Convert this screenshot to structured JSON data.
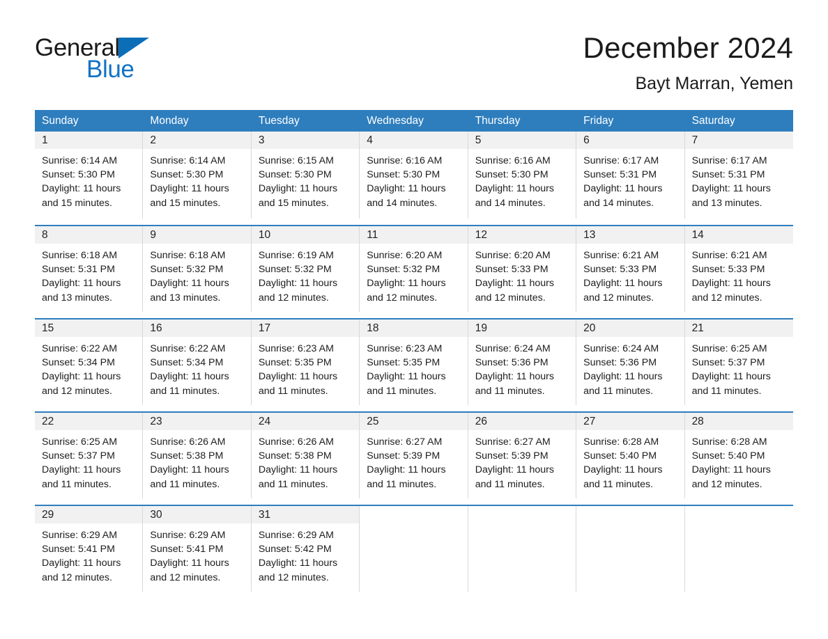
{
  "brand": {
    "name_part1": "General",
    "name_part2": "Blue",
    "triangle_color": "#0d6eb8",
    "blue_text_color": "#1272c4"
  },
  "header": {
    "title": "December 2024",
    "subtitle": "Bayt Marran, Yemen"
  },
  "theme": {
    "header_blue": "#2e7ebe",
    "daynum_band": "#f1f1f1",
    "text": "#1c1c1c",
    "cell_border": "#d8d8d8"
  },
  "weekdays": [
    "Sunday",
    "Monday",
    "Tuesday",
    "Wednesday",
    "Thursday",
    "Friday",
    "Saturday"
  ],
  "weeks": [
    [
      {
        "day": "1",
        "sunrise": "Sunrise: 6:14 AM",
        "sunset": "Sunset: 5:30 PM",
        "daylight1": "Daylight: 11 hours",
        "daylight2": "and 15 minutes."
      },
      {
        "day": "2",
        "sunrise": "Sunrise: 6:14 AM",
        "sunset": "Sunset: 5:30 PM",
        "daylight1": "Daylight: 11 hours",
        "daylight2": "and 15 minutes."
      },
      {
        "day": "3",
        "sunrise": "Sunrise: 6:15 AM",
        "sunset": "Sunset: 5:30 PM",
        "daylight1": "Daylight: 11 hours",
        "daylight2": "and 15 minutes."
      },
      {
        "day": "4",
        "sunrise": "Sunrise: 6:16 AM",
        "sunset": "Sunset: 5:30 PM",
        "daylight1": "Daylight: 11 hours",
        "daylight2": "and 14 minutes."
      },
      {
        "day": "5",
        "sunrise": "Sunrise: 6:16 AM",
        "sunset": "Sunset: 5:30 PM",
        "daylight1": "Daylight: 11 hours",
        "daylight2": "and 14 minutes."
      },
      {
        "day": "6",
        "sunrise": "Sunrise: 6:17 AM",
        "sunset": "Sunset: 5:31 PM",
        "daylight1": "Daylight: 11 hours",
        "daylight2": "and 14 minutes."
      },
      {
        "day": "7",
        "sunrise": "Sunrise: 6:17 AM",
        "sunset": "Sunset: 5:31 PM",
        "daylight1": "Daylight: 11 hours",
        "daylight2": "and 13 minutes."
      }
    ],
    [
      {
        "day": "8",
        "sunrise": "Sunrise: 6:18 AM",
        "sunset": "Sunset: 5:31 PM",
        "daylight1": "Daylight: 11 hours",
        "daylight2": "and 13 minutes."
      },
      {
        "day": "9",
        "sunrise": "Sunrise: 6:18 AM",
        "sunset": "Sunset: 5:32 PM",
        "daylight1": "Daylight: 11 hours",
        "daylight2": "and 13 minutes."
      },
      {
        "day": "10",
        "sunrise": "Sunrise: 6:19 AM",
        "sunset": "Sunset: 5:32 PM",
        "daylight1": "Daylight: 11 hours",
        "daylight2": "and 12 minutes."
      },
      {
        "day": "11",
        "sunrise": "Sunrise: 6:20 AM",
        "sunset": "Sunset: 5:32 PM",
        "daylight1": "Daylight: 11 hours",
        "daylight2": "and 12 minutes."
      },
      {
        "day": "12",
        "sunrise": "Sunrise: 6:20 AM",
        "sunset": "Sunset: 5:33 PM",
        "daylight1": "Daylight: 11 hours",
        "daylight2": "and 12 minutes."
      },
      {
        "day": "13",
        "sunrise": "Sunrise: 6:21 AM",
        "sunset": "Sunset: 5:33 PM",
        "daylight1": "Daylight: 11 hours",
        "daylight2": "and 12 minutes."
      },
      {
        "day": "14",
        "sunrise": "Sunrise: 6:21 AM",
        "sunset": "Sunset: 5:33 PM",
        "daylight1": "Daylight: 11 hours",
        "daylight2": "and 12 minutes."
      }
    ],
    [
      {
        "day": "15",
        "sunrise": "Sunrise: 6:22 AM",
        "sunset": "Sunset: 5:34 PM",
        "daylight1": "Daylight: 11 hours",
        "daylight2": "and 12 minutes."
      },
      {
        "day": "16",
        "sunrise": "Sunrise: 6:22 AM",
        "sunset": "Sunset: 5:34 PM",
        "daylight1": "Daylight: 11 hours",
        "daylight2": "and 11 minutes."
      },
      {
        "day": "17",
        "sunrise": "Sunrise: 6:23 AM",
        "sunset": "Sunset: 5:35 PM",
        "daylight1": "Daylight: 11 hours",
        "daylight2": "and 11 minutes."
      },
      {
        "day": "18",
        "sunrise": "Sunrise: 6:23 AM",
        "sunset": "Sunset: 5:35 PM",
        "daylight1": "Daylight: 11 hours",
        "daylight2": "and 11 minutes."
      },
      {
        "day": "19",
        "sunrise": "Sunrise: 6:24 AM",
        "sunset": "Sunset: 5:36 PM",
        "daylight1": "Daylight: 11 hours",
        "daylight2": "and 11 minutes."
      },
      {
        "day": "20",
        "sunrise": "Sunrise: 6:24 AM",
        "sunset": "Sunset: 5:36 PM",
        "daylight1": "Daylight: 11 hours",
        "daylight2": "and 11 minutes."
      },
      {
        "day": "21",
        "sunrise": "Sunrise: 6:25 AM",
        "sunset": "Sunset: 5:37 PM",
        "daylight1": "Daylight: 11 hours",
        "daylight2": "and 11 minutes."
      }
    ],
    [
      {
        "day": "22",
        "sunrise": "Sunrise: 6:25 AM",
        "sunset": "Sunset: 5:37 PM",
        "daylight1": "Daylight: 11 hours",
        "daylight2": "and 11 minutes."
      },
      {
        "day": "23",
        "sunrise": "Sunrise: 6:26 AM",
        "sunset": "Sunset: 5:38 PM",
        "daylight1": "Daylight: 11 hours",
        "daylight2": "and 11 minutes."
      },
      {
        "day": "24",
        "sunrise": "Sunrise: 6:26 AM",
        "sunset": "Sunset: 5:38 PM",
        "daylight1": "Daylight: 11 hours",
        "daylight2": "and 11 minutes."
      },
      {
        "day": "25",
        "sunrise": "Sunrise: 6:27 AM",
        "sunset": "Sunset: 5:39 PM",
        "daylight1": "Daylight: 11 hours",
        "daylight2": "and 11 minutes."
      },
      {
        "day": "26",
        "sunrise": "Sunrise: 6:27 AM",
        "sunset": "Sunset: 5:39 PM",
        "daylight1": "Daylight: 11 hours",
        "daylight2": "and 11 minutes."
      },
      {
        "day": "27",
        "sunrise": "Sunrise: 6:28 AM",
        "sunset": "Sunset: 5:40 PM",
        "daylight1": "Daylight: 11 hours",
        "daylight2": "and 11 minutes."
      },
      {
        "day": "28",
        "sunrise": "Sunrise: 6:28 AM",
        "sunset": "Sunset: 5:40 PM",
        "daylight1": "Daylight: 11 hours",
        "daylight2": "and 12 minutes."
      }
    ],
    [
      {
        "day": "29",
        "sunrise": "Sunrise: 6:29 AM",
        "sunset": "Sunset: 5:41 PM",
        "daylight1": "Daylight: 11 hours",
        "daylight2": "and 12 minutes."
      },
      {
        "day": "30",
        "sunrise": "Sunrise: 6:29 AM",
        "sunset": "Sunset: 5:41 PM",
        "daylight1": "Daylight: 11 hours",
        "daylight2": "and 12 minutes."
      },
      {
        "day": "31",
        "sunrise": "Sunrise: 6:29 AM",
        "sunset": "Sunset: 5:42 PM",
        "daylight1": "Daylight: 11 hours",
        "daylight2": "and 12 minutes."
      },
      {
        "day": "",
        "sunrise": "",
        "sunset": "",
        "daylight1": "",
        "daylight2": ""
      },
      {
        "day": "",
        "sunrise": "",
        "sunset": "",
        "daylight1": "",
        "daylight2": ""
      },
      {
        "day": "",
        "sunrise": "",
        "sunset": "",
        "daylight1": "",
        "daylight2": ""
      },
      {
        "day": "",
        "sunrise": "",
        "sunset": "",
        "daylight1": "",
        "daylight2": ""
      }
    ]
  ]
}
